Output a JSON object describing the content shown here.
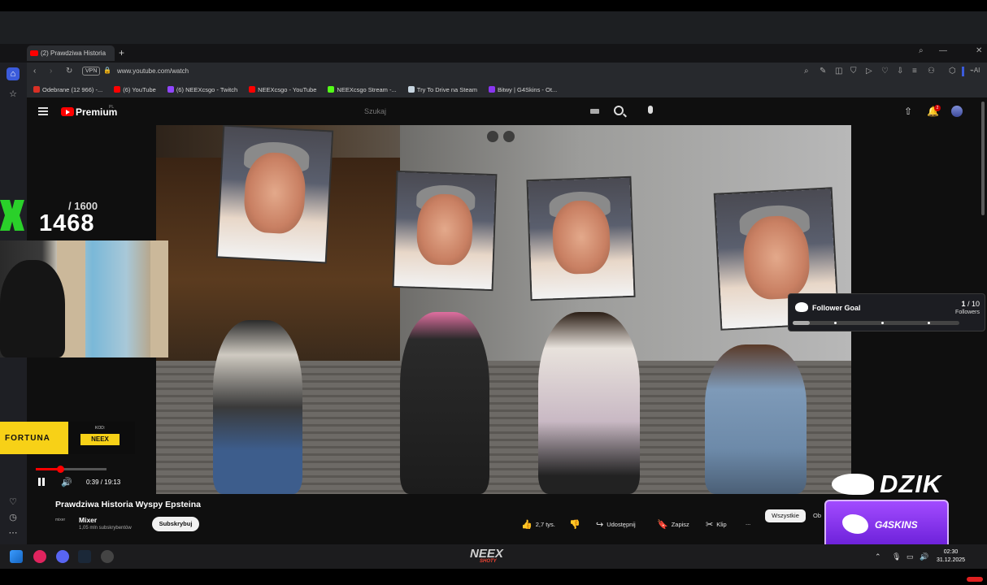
{
  "browser": {
    "tab_title": "(2) Prawdziwa Historia",
    "new_tab": "+",
    "vpn_label": "VPN",
    "url": "www.youtube.com/watch",
    "ai_label": "AI",
    "bookmarks": [
      "Odebrane (12 966) -...",
      "(6) YouTube",
      "(6) NEEXcsgo - Twitch",
      "NEEXcsgo - YouTube",
      "NEEXcsgo Stream -...",
      "Try To Drive na Steam",
      "Bitwy | G4Skins - Ot..."
    ]
  },
  "youtube": {
    "brand": "Premium",
    "region": "PL",
    "search_placeholder": "Szukaj",
    "notification_count": "2",
    "video_title": "Prawdziwa Historia Wyspy Epsteina",
    "channel_name": "Mixer",
    "channel_logo": "mixer",
    "channel_subs": "1,05 mln subskrybentów",
    "subscribe_label": "Subskrybuj",
    "actions": {
      "likes": "2,7 tys.",
      "share": "Udostępnij",
      "save": "Zapisz",
      "clip": "Klip",
      "more": "..."
    },
    "chips": [
      "Wszystkie",
      "Ob"
    ],
    "player": {
      "time": "0:39 / 19:13",
      "progress": 0.034
    }
  },
  "overlay": {
    "counter_total": "/ 1600",
    "counter_value": "1468",
    "fortuna_label": "FORTUNA",
    "kod_label": "KOD:",
    "kod_value": "NEEX",
    "follower_goal": {
      "title": "Follower Goal",
      "current": "1",
      "target": "/ 10",
      "unit": "Followers",
      "progress": 0.1
    },
    "dzik_label": "DZIK",
    "g4skins_label": "G4SKINS",
    "neex_logo": "NEEX",
    "neex_sub": "SHOTY"
  },
  "taskbar": {
    "time": "02:30",
    "date": "31.12.2025"
  },
  "colors": {
    "youtube_red": "#ff0000",
    "fortuna_yellow": "#f7d117",
    "g4skins_purple": "#8a36f0",
    "page_bg": "#0f0f0f"
  }
}
